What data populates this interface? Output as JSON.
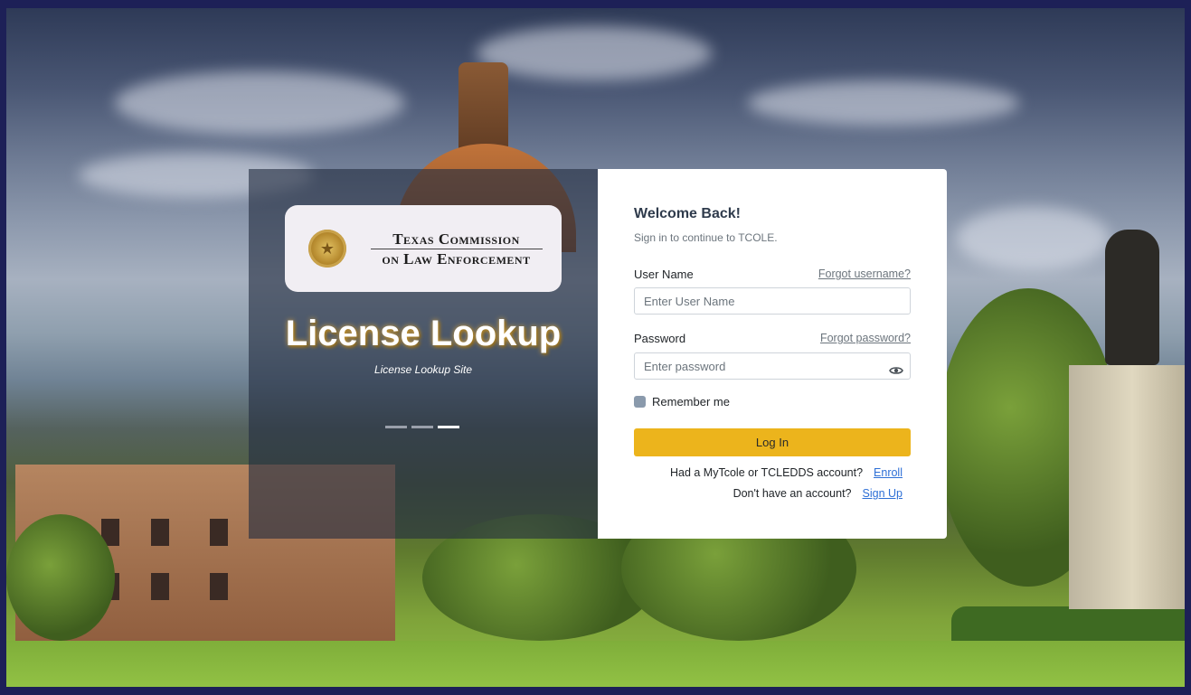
{
  "brand": {
    "line1": "Texas Commission",
    "line2": "on Law Enforcement"
  },
  "hero": {
    "title": "License Lookup",
    "subtitle": "License Lookup Site",
    "slides": [
      {
        "active": false
      },
      {
        "active": false
      },
      {
        "active": true
      }
    ]
  },
  "login": {
    "title": "Welcome Back!",
    "subtitle": "Sign in to continue to TCOLE.",
    "username_label": "User Name",
    "forgot_username": "Forgot username?",
    "username_placeholder": "Enter User Name",
    "password_label": "Password",
    "forgot_password": "Forgot password?",
    "password_placeholder": "Enter password",
    "remember_label": "Remember me",
    "login_button": "Log In",
    "enroll_text": "Had a MyTcole or TCLEDDS account?",
    "enroll_link": "Enroll",
    "signup_text": "Don't have an account?",
    "signup_link": "Sign Up"
  },
  "colors": {
    "accent": "#ecb41c",
    "link": "#2d6fd6",
    "frame": "#1d2057"
  }
}
